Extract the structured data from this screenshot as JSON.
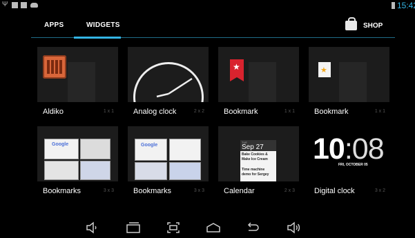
{
  "status_bar": {
    "time": "15:42",
    "left_icons": [
      "usb-icon",
      "notification-icon",
      "notification-icon",
      "android-icon"
    ],
    "right_icons": [
      "battery-icon"
    ]
  },
  "tabs": [
    {
      "label": "APPS",
      "selected": false
    },
    {
      "label": "WIDGETS",
      "selected": true
    }
  ],
  "shop": {
    "label": "SHOP",
    "icon": "shopping-bag-icon"
  },
  "accent_color": "#33b5e5",
  "widgets": [
    {
      "name": "Aldiko",
      "size": "1 x 1"
    },
    {
      "name": "Analog clock",
      "size": "2 x 2"
    },
    {
      "name": "Bookmark",
      "size": "1 x 1"
    },
    {
      "name": "Bookmark",
      "size": "1 x 1"
    },
    {
      "name": "Bookmarks",
      "size": "3 x 3"
    },
    {
      "name": "Bookmarks",
      "size": "3 x 3"
    },
    {
      "name": "Calendar",
      "size": "2 x 3"
    },
    {
      "name": "Digital clock",
      "size": "3 x 2"
    }
  ],
  "previews": {
    "google": "Google",
    "calendar": {
      "day": "TUE",
      "date": "Sep 27",
      "events": [
        "Bake Cookies &",
        "Make Ice Cream",
        "Time machine",
        "demo for Sergey"
      ]
    },
    "digital_clock": {
      "hour": "10",
      "minute": ":08",
      "date": "FRI, OCTOBER 05"
    }
  },
  "navigation": [
    "volume-down-icon",
    "back-icon",
    "screenshot-icon",
    "home-icon",
    "back-arrow-icon",
    "volume-up-icon"
  ]
}
